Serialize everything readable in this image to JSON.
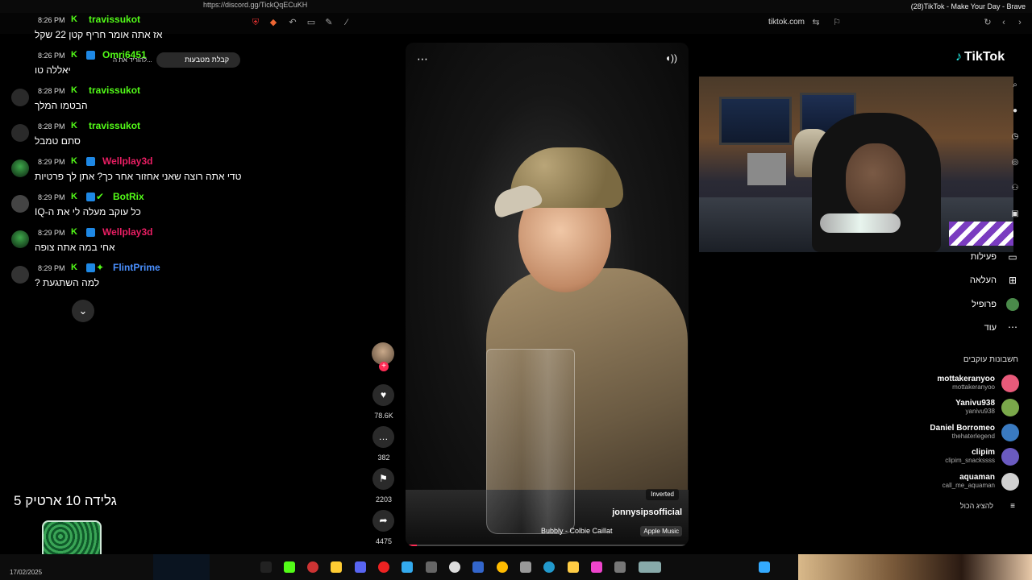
{
  "browser": {
    "window_title": "(28)TikTok - Make Your Day - Brave",
    "top_url_fragment": "https://discord.gg/TickQqECuKH",
    "site": "tiktok.com"
  },
  "chat": {
    "messages": [
      {
        "time": "8:26 PM",
        "user": "travissukot",
        "user_color": "#53fc18",
        "text": "אז אתה אומר חריף קטן 22 שקל"
      },
      {
        "time": "8:26 PM",
        "user": "Omri6451",
        "user_color": "#53fc18",
        "text": "יאללה טו"
      },
      {
        "time": "8:28 PM",
        "user": "travissukot",
        "user_color": "#53fc18",
        "text": "הבטמו המלך"
      },
      {
        "time": "8:28 PM",
        "user": "travissukot",
        "user_color": "#53fc18",
        "text": "סתם טמבל"
      },
      {
        "time": "8:29 PM",
        "user": "Wellplay3d",
        "user_color": "#e91e63",
        "text": "טדי אתה רוצה שאני אחזור אחר כך? אתן לך פרטיות"
      },
      {
        "time": "8:29 PM",
        "user": "BotRix",
        "user_color": "#53fc18",
        "text": "כל עוקב מעלה לי את ה-IQ"
      },
      {
        "time": "8:29 PM",
        "user": "Wellplay3d",
        "user_color": "#e91e63",
        "text": "אחי במה אתה צופה"
      },
      {
        "time": "8:29 PM",
        "user": "FlintPrime",
        "user_color": "#4a90ff",
        "text": "למה השתגעת ?"
      }
    ],
    "notification": {
      "label": "קבלת מטבעות",
      "sub": "להוריד את ה..."
    }
  },
  "video": {
    "username": "jonnysipsofficial",
    "music": "Bubbly - Colbie Caillat",
    "apple_music": "Apple Music",
    "effect": "Inverted",
    "progress": 0.04
  },
  "actions": {
    "likes": "78.6K",
    "comments": "382",
    "saves": "2203",
    "shares": "4475"
  },
  "sidebar": {
    "logo": "TikTok",
    "nav": [
      {
        "label": "פעילות",
        "icon": "message-icon"
      },
      {
        "label": "העלאה",
        "icon": "upload-icon"
      },
      {
        "label": "פרופיל",
        "icon": "profile-icon"
      },
      {
        "label": "עוד",
        "icon": "more-icon"
      }
    ],
    "following_title": "חשבונות עוקבים",
    "accounts": [
      {
        "name": "mottakeranyoo",
        "handle": "mottakeranyoo",
        "color": "#e85a7a"
      },
      {
        "name": "Yanivu938",
        "handle": "yanivu938",
        "color": "#7aa84a"
      },
      {
        "name": "Daniel Borromeo",
        "handle": "thehaterlegend",
        "color": "#3a7ac0"
      },
      {
        "name": "clipim",
        "handle": "clipim_snackssss",
        "color": "#6a5ac0"
      },
      {
        "name": "aquaman",
        "handle": "call_me_aquaman",
        "color": "#d0d0d0"
      }
    ],
    "show_all": "להציג הכול"
  },
  "overlay": {
    "title": "גלידה 10 ארטיק 5"
  },
  "taskbar": {
    "date": "17/02/2025"
  }
}
